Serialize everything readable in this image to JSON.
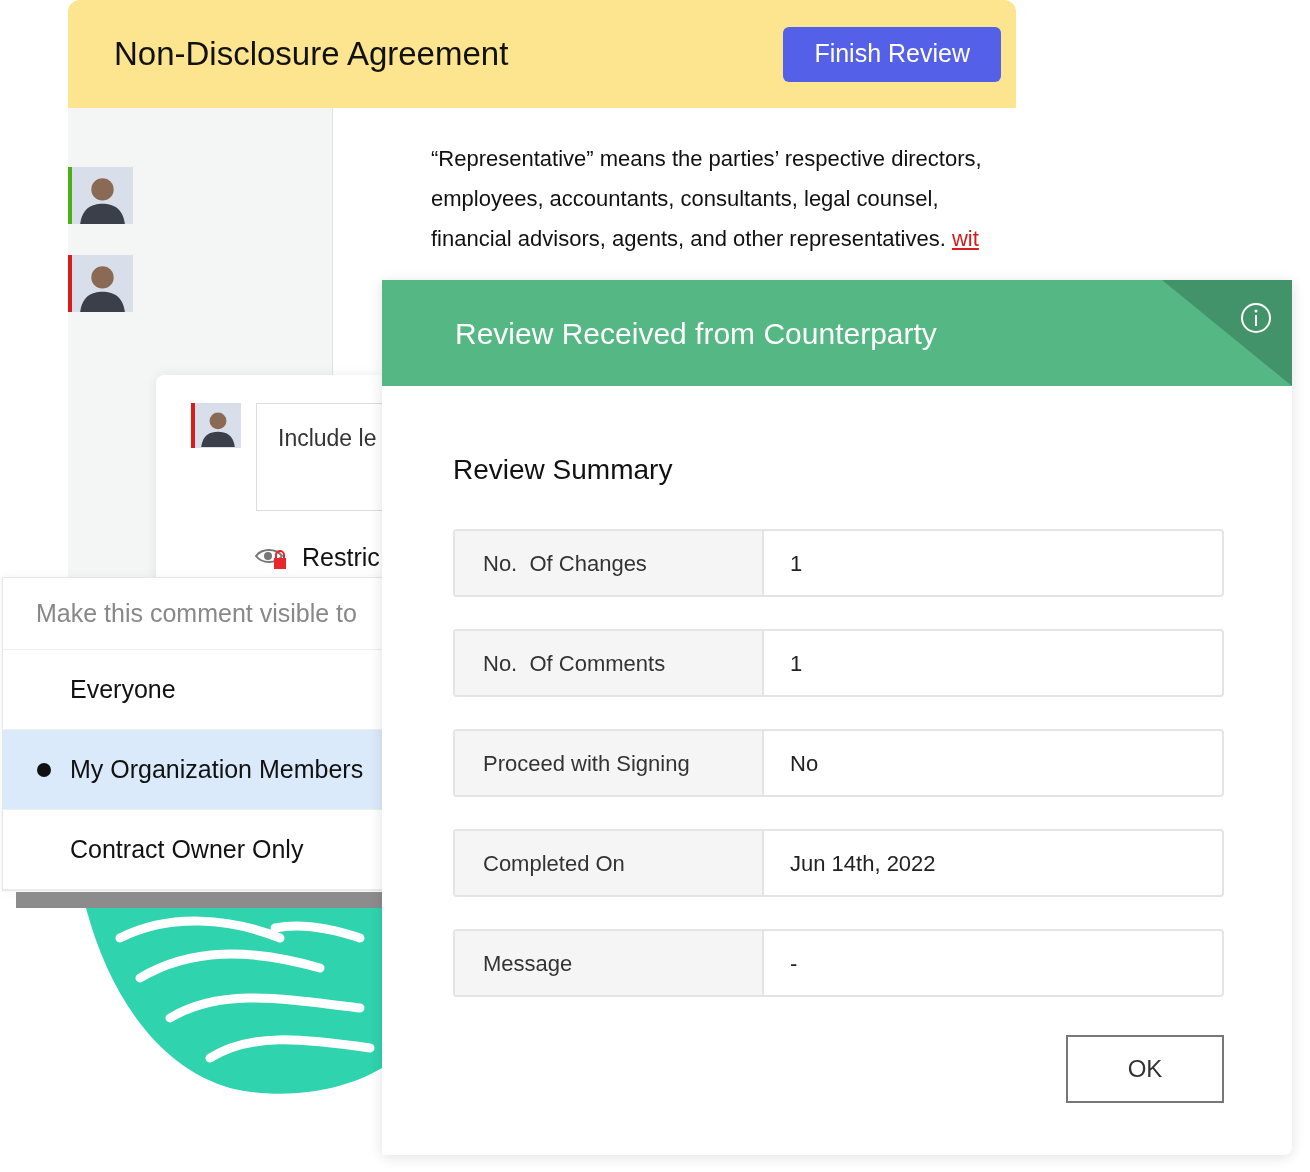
{
  "document": {
    "title": "Non-Disclosure Agreement",
    "finish_button": "Finish Review",
    "reviewers": [
      {
        "color": "#4caf18"
      },
      {
        "color": "#d81b1b"
      }
    ],
    "paragraph_lines": [
      {
        "text": "“Representative” means the parties’ respective directors,"
      },
      {
        "text": "employees, accountants, consultants, legal counsel,"
      },
      {
        "text": "financial advisors, agents, and other representatives. ",
        "insert": "wit"
      }
    ]
  },
  "comment": {
    "author": {
      "color": "#d81b1b"
    },
    "text": "Include le",
    "restriction": "Restric"
  },
  "visibility_menu": {
    "heading": "Make this comment visible to",
    "options": [
      {
        "label": "Everyone",
        "selected": false
      },
      {
        "label": "My Organization Members",
        "selected": true
      },
      {
        "label": "Contract Owner Only",
        "selected": false
      }
    ]
  },
  "dialog": {
    "title": "Review Received from Counterparty",
    "section_title": "Review Summary",
    "rows": [
      {
        "label": "No.  Of Changes",
        "value": "1"
      },
      {
        "label": "No.  Of Comments",
        "value": "1"
      },
      {
        "label": "Proceed with Signing",
        "value": "No"
      },
      {
        "label": "Completed On",
        "value": "Jun 14th, 2022"
      },
      {
        "label": "Message",
        "value": "-"
      }
    ],
    "ok_button": "OK"
  }
}
